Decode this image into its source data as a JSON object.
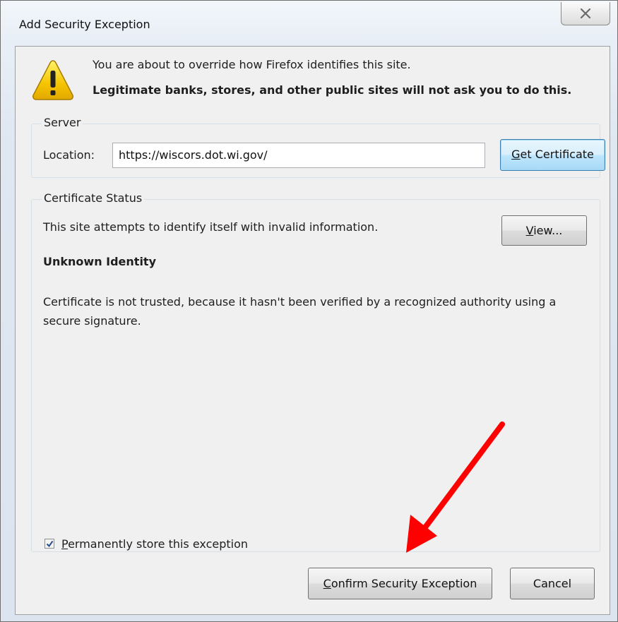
{
  "window": {
    "title": "Add Security Exception",
    "close_icon": "close-x-icon"
  },
  "message": {
    "line1": "You are about to override how Firefox identifies this site.",
    "line2": "Legitimate banks, stores, and other public sites will not ask you to do this.",
    "icon": "warning-icon"
  },
  "server": {
    "legend": "Server",
    "location_label": "Location:",
    "location_value": "https://wiscors.dot.wi.gov/",
    "get_cert_accel": "G",
    "get_cert_rest": "et Certificate"
  },
  "certificate": {
    "legend": "Certificate Status",
    "status_text": "This site attempts to identify itself with invalid information.",
    "view_accel": "V",
    "view_rest": "iew...",
    "heading": "Unknown Identity",
    "reason": "Certificate is not trusted, because it hasn't been verified by a recognized authority using a secure signature."
  },
  "permanent": {
    "checked": true,
    "label_accel": "P",
    "label_rest": "ermanently store this exception"
  },
  "buttons": {
    "confirm_accel": "C",
    "confirm_rest": "onfirm Security Exception",
    "cancel": "Cancel"
  },
  "annotation": {
    "arrow_color": "#ff0000"
  },
  "colors": {
    "button_focus_border": "#3c7fb1",
    "warning_yellow": "#f5c400"
  }
}
